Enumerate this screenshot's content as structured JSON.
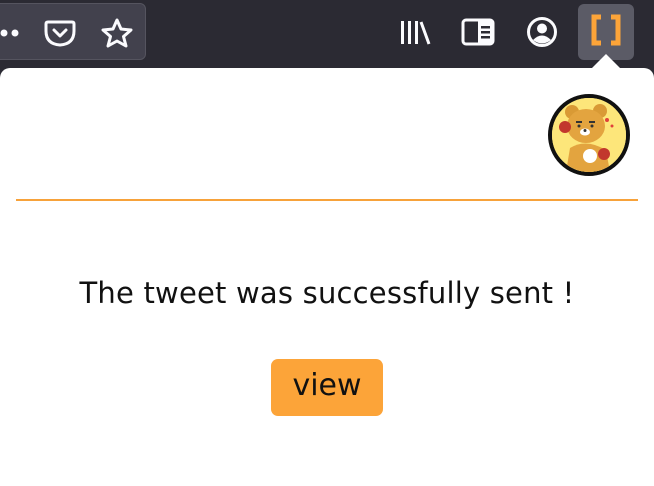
{
  "toolbar": {
    "icons": [
      "overflow-dots-icon",
      "pocket-icon",
      "bookmark-star-icon",
      "library-icon",
      "reader-view-icon",
      "account-icon",
      "extension-icon"
    ]
  },
  "popup": {
    "avatar": "ryan-character-avatar",
    "message": "The tweet was successfully sent !",
    "view_label": "view"
  },
  "colors": {
    "accent": "#fca439",
    "divider": "#f7a23a",
    "toolbar_bg": "#2b2a33",
    "popup_bg": "#ffffff"
  }
}
